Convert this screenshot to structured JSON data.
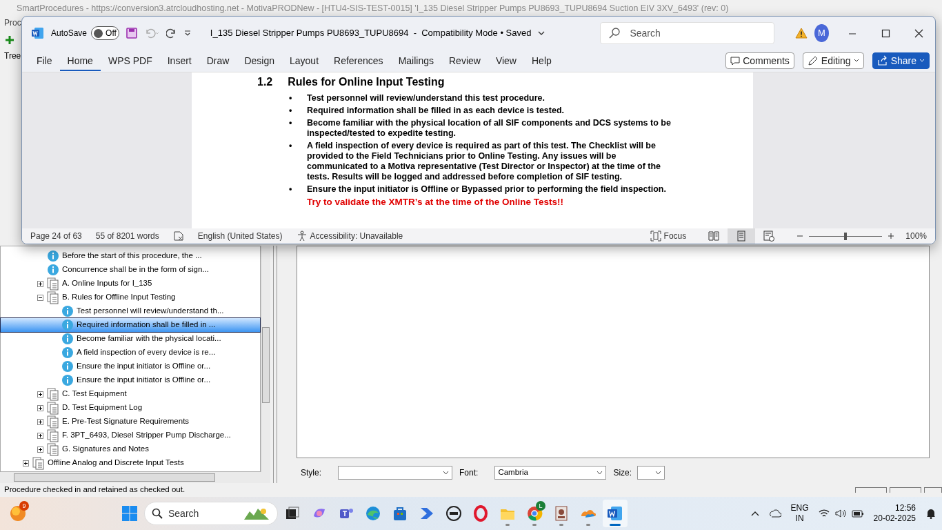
{
  "app": {
    "title": "SmartProcedures - https://conversion3.atrcloudhosting.net - MotivaPRODNew - [HTU4-SIS-TEST-0015] 'I_135 Diesel Stripper Pumps PU8693_TUPU8694 Suction EIV 3XV_6493' (rev: 0)",
    "menu": "Proc",
    "tree_label": "Tree",
    "tree": [
      {
        "children": [
          {
            "kind": "info",
            "label": "Before the start of this procedure, the ...",
            "selected": false
          },
          {
            "kind": "info",
            "label": "Concurrence shall be in the form of sign...",
            "selected": false
          },
          {
            "kind": "section",
            "label": "A. Online Inputs for I_135",
            "expanded": false,
            "selected": false
          },
          {
            "kind": "section",
            "label": "B. Rules for Offline Input Testing",
            "expanded": true,
            "selected": false,
            "children": [
              {
                "kind": "info",
                "label": "Test personnel will review/understand th...",
                "selected": false
              },
              {
                "kind": "info",
                "label": "Required information shall be filled in ...",
                "selected": true
              },
              {
                "kind": "info",
                "label": "Become familiar with the physical locati...",
                "selected": false
              },
              {
                "kind": "info",
                "label": "A field inspection of every device is re...",
                "selected": false
              },
              {
                "kind": "info",
                "label": "Ensure the input initiator is Offline or...",
                "selected": false
              },
              {
                "kind": "info",
                "label": "Ensure the input initiator is Offline or...",
                "selected": false
              }
            ]
          },
          {
            "kind": "section",
            "label": "C. Test Equipment",
            "expanded": false,
            "selected": false
          },
          {
            "kind": "section",
            "label": "D. Test Equipment Log",
            "expanded": false,
            "selected": false
          },
          {
            "kind": "section",
            "label": "E. Pre-Test Signature Requirements",
            "expanded": false,
            "selected": false
          },
          {
            "kind": "section",
            "label": "F. 3PT_6493, Diesel Stripper Pump Discharge...",
            "expanded": false,
            "selected": false
          },
          {
            "kind": "section",
            "label": "G. Signatures and Notes",
            "expanded": false,
            "selected": false
          }
        ]
      },
      {
        "kind": "section",
        "label": "Offline Analog and Discrete Input Tests",
        "expanded": false,
        "selected": false
      }
    ],
    "format_bar": {
      "style_label": "Style:",
      "font_label": "Font:",
      "font_value": "Cambria",
      "size_label": "Size:"
    },
    "status": "Procedure checked in and retained as checked out."
  },
  "word": {
    "autosave": {
      "label": "AutoSave",
      "state_text": "Off",
      "on": false
    },
    "title": "I_135 Diesel Stripper Pumps PU8693_TUPU8694  -  Compatibility Mode • Saved",
    "search": {
      "placeholder": "Search"
    },
    "avatar": "M",
    "tabs": [
      {
        "label": "File",
        "selected": false
      },
      {
        "label": "Home",
        "selected": true
      },
      {
        "label": "WPS PDF",
        "selected": false
      },
      {
        "label": "Insert",
        "selected": false
      },
      {
        "label": "Draw",
        "selected": false
      },
      {
        "label": "Design",
        "selected": false
      },
      {
        "label": "Layout",
        "selected": false
      },
      {
        "label": "References",
        "selected": false
      },
      {
        "label": "Mailings",
        "selected": false
      },
      {
        "label": "Review",
        "selected": false
      },
      {
        "label": "View",
        "selected": false
      },
      {
        "label": "Help",
        "selected": false
      }
    ],
    "buttons": {
      "comments": "Comments",
      "editing": "Editing",
      "share": "Share"
    },
    "document": {
      "number": "1.2",
      "heading": "Rules for Online Input Testing",
      "bullets": [
        "Test personnel will review/understand this test procedure.",
        "Required information shall be filled in as each device is tested.",
        "Become familiar with the physical location of all SIF components and DCS systems to be inspected/tested to expedite testing.",
        "A field inspection of every device is required as part of this test. The Checklist will be provided to the Field Technicians prior to Online Testing. Any issues will be communicated to a Motiva representative (Test Director or Inspector) at the time of the tests. Results will be logged and addressed before completion of SIF testing.",
        "Ensure the input initiator is Offline or Bypassed prior to performing the field inspection."
      ],
      "marker": "•",
      "note": "Try to validate the XMTR’s at the time of the Online Tests!!"
    },
    "status_bar": {
      "page": "Page 24 of 63",
      "words": "55 of 8201 words",
      "language": "English (United States)",
      "accessibility": "Accessibility: Unavailable",
      "focus": "Focus",
      "views": [
        {
          "kind": "read",
          "selected": false
        },
        {
          "kind": "print",
          "selected": true
        },
        {
          "kind": "web",
          "selected": false
        }
      ],
      "zoom": {
        "level": 0.5,
        "text": "100%"
      }
    }
  },
  "taskbar": {
    "weather_badge": "9",
    "search_placeholder": "Search",
    "apps": [
      {
        "kind": "taskview",
        "running": false,
        "selected": false
      },
      {
        "kind": "copilot",
        "running": false,
        "selected": false
      },
      {
        "kind": "teams",
        "running": false,
        "selected": false
      },
      {
        "kind": "edge",
        "running": false,
        "selected": false
      },
      {
        "kind": "store",
        "running": false,
        "selected": false
      },
      {
        "kind": "automate",
        "running": false,
        "selected": false
      },
      {
        "kind": "dell",
        "running": false,
        "selected": false
      },
      {
        "kind": "opera",
        "running": false,
        "selected": false
      },
      {
        "kind": "explorer",
        "running": true,
        "selected": false
      },
      {
        "kind": "chrome",
        "running": true,
        "selected": false,
        "badge": "L"
      },
      {
        "kind": "badge-app",
        "running": true,
        "selected": false
      },
      {
        "kind": "cloud-app",
        "running": true,
        "selected": false
      },
      {
        "kind": "word",
        "running": true,
        "selected": true
      }
    ],
    "language": "ENG",
    "region": "IN",
    "time": "12:56",
    "date": "20-02-2025"
  }
}
